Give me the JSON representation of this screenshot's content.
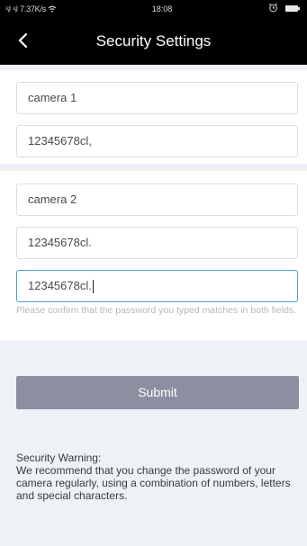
{
  "status_bar": {
    "signal": "ᵌᵢl ᵌᵢl 7.37K/s",
    "time": "18:08"
  },
  "header": {
    "title": "Security Settings"
  },
  "camera_1": {
    "name": "camera 1",
    "password": "12345678cl,"
  },
  "camera_2": {
    "name": "camera 2",
    "password": "12345678cl.",
    "confirm_password": "12345678cl."
  },
  "hint": "Please confirm that the password you typed matches in both fields.",
  "submit_label": "Submit",
  "warning": {
    "title": "Security Warning:",
    "body": "We recommend that you change the password of your camera regularly, using a combination of numbers, letters and special characters."
  },
  "icons": {
    "back": "chevron-left-icon",
    "wifi": "wifi-icon",
    "alarm": "alarm-icon",
    "battery": "battery-icon"
  },
  "colors": {
    "header_bg": "#000000",
    "focus_border": "#4a9fd8",
    "submit_bg": "#8b8fa0",
    "page_bg": "#eef1f5"
  }
}
